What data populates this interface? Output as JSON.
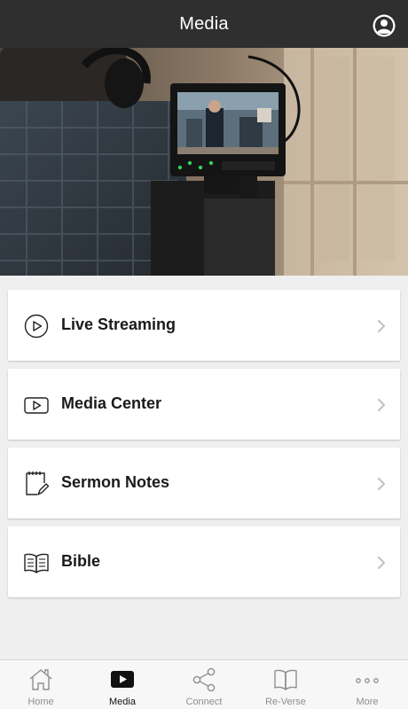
{
  "header": {
    "title": "Media",
    "account_icon": "user-circle-icon"
  },
  "hero": {
    "description_icon": "camera-monitor-photo"
  },
  "menu": {
    "items": [
      {
        "label": "Live Streaming",
        "icon": "play-circle-icon"
      },
      {
        "label": "Media Center",
        "icon": "play-rectangle-icon"
      },
      {
        "label": "Sermon Notes",
        "icon": "notepad-pen-icon"
      },
      {
        "label": "Bible",
        "icon": "open-book-icon"
      }
    ]
  },
  "tabbar": {
    "active": "Media",
    "tabs": [
      {
        "label": "Home",
        "icon": "home-icon"
      },
      {
        "label": "Media",
        "icon": "play-icon"
      },
      {
        "label": "Connect",
        "icon": "share-icon"
      },
      {
        "label": "Re-Verse",
        "icon": "book-icon"
      },
      {
        "label": "More",
        "icon": "more-dots-icon"
      }
    ]
  },
  "colors": {
    "header_bg": "#2f2f2f",
    "page_bg": "#efefef",
    "card_bg": "#ffffff",
    "tab_inactive": "#8e8e8e",
    "tab_active": "#111111"
  }
}
